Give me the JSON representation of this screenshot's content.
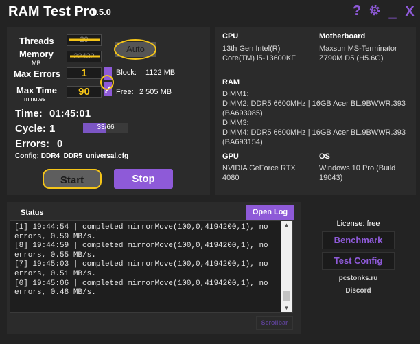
{
  "titlebar": {
    "title": "RAM Test Pro",
    "version": "1.5.0",
    "help_glyph": "?",
    "minimize_glyph": "_",
    "close_glyph": "X"
  },
  "settings": {
    "threads_label": "Threads",
    "threads_value": "20",
    "memory_label": "Memory",
    "memory_unit": "MB",
    "memory_value": "22432",
    "auto_label": "Auto",
    "max_errors_label": "Max Errors",
    "max_errors_value": "1",
    "block_label": "Block:",
    "block_value": "1122 MB",
    "max_time_label": "Max Time",
    "max_time_unit": "minutes",
    "max_time_value": "90",
    "free_label": "Free:",
    "free_value": "2 505 MB",
    "time_label": "Time:",
    "time_value": "01:45:01",
    "cycle_label": "Cycle:",
    "cycle_value": "1",
    "cycle_progress_text": "33/66",
    "cycle_progress_fraction": 0.5,
    "errors_label": "Errors:",
    "errors_value": "0",
    "config_label": "Config:",
    "config_value": "DDR4_DDR5_universal.cfg",
    "start_label": "Start",
    "stop_label": "Stop"
  },
  "system": {
    "cpu_heading": "CPU",
    "cpu_value": "13th Gen Intel(R)\nCore(TM) i5-13600KF",
    "motherboard_heading": "Motherboard",
    "motherboard_value": "Maxsun MS-Terminator\nZ790M D5 (H5.6G)",
    "ram_heading": "RAM",
    "ram_value": "DIMM1:\nDIMM2: DDR5 6600MHz | 16GB Acer BL.9BWWR.393\n(BA693085)\nDIMM3:\nDIMM4: DDR5 6600MHz | 16GB Acer BL.9BWWR.393\n(BA693154)",
    "gpu_heading": "GPU",
    "gpu_value": "NVIDIA GeForce RTX\n4080",
    "os_heading": "OS",
    "os_value": "Windows 10 Pro (Build\n19043)"
  },
  "status": {
    "tab_label": "Status",
    "open_log_label": "Open Log",
    "log_text": "[1] 19:44:54 | completed mirrorMove(100,0,4194200,1), no\nerrors, 0.59 MB/s.\n[8] 19:44:59 | completed mirrorMove(100,0,4194200,1), no\nerrors, 0.55 MB/s.\n[7] 19:45:03 | completed mirrorMove(100,0,4194200,1), no\nerrors, 0.51 MB/s.\n[0] 19:45:06 | completed mirrorMove(100,0,4194200,1), no\nerrors, 0.48 MB/s.",
    "scrollbar_label": "Scrollbar",
    "scroll_up_glyph": "▲",
    "scroll_down_glyph": "▼"
  },
  "sidebar": {
    "license_text": "License: free",
    "benchmark_label": "Benchmark",
    "test_config_label": "Test Config",
    "site_link": "pcstonks.ru",
    "discord_link": "Discord"
  },
  "colors": {
    "accent": "#8e5ad8",
    "background": "#232323",
    "panel": "#2b2b2b",
    "highlight_annotation": "#f5c518"
  }
}
